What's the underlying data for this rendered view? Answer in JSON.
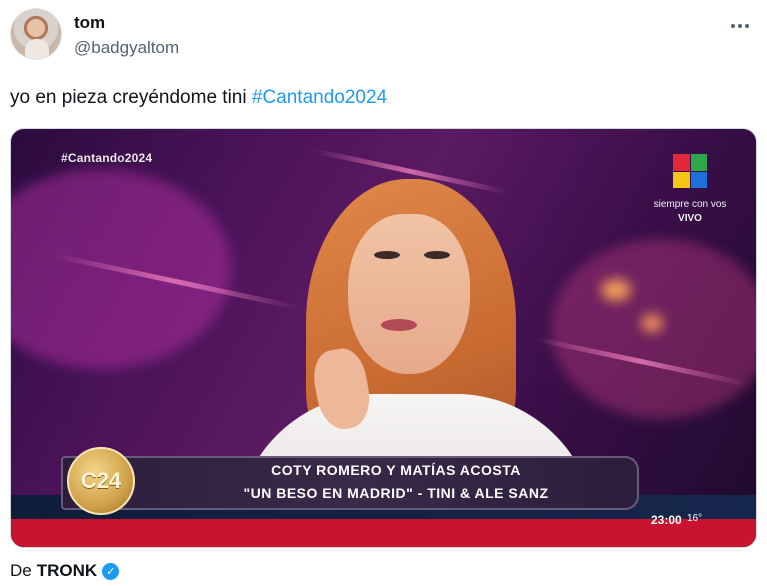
{
  "author": {
    "display_name": "tom",
    "handle": "@badgyaltom",
    "avatar_icon": "profile-photo"
  },
  "tweet": {
    "text": "yo en pieza creyéndome tini ",
    "hashtag": "#Cantando2024"
  },
  "media": {
    "watermark_hashtag": "#Cantando2024",
    "channel_slogan": "siempre con vos",
    "live_label": "VIVO",
    "program_logo": "C24",
    "lower_third": {
      "line1": "COTY ROMERO Y MATÍAS ACOSTA",
      "line2": "\"UN BESO EN MADRID\" - TINI & ALE SANZ"
    },
    "clock": "23:00",
    "temperature": "16°"
  },
  "source": {
    "prefix": "De",
    "name": "TRONK",
    "verified_icon": "verified-badge-icon"
  },
  "colors": {
    "link": "#1d9bf0",
    "text": "#0f1419",
    "muted": "#536471"
  }
}
